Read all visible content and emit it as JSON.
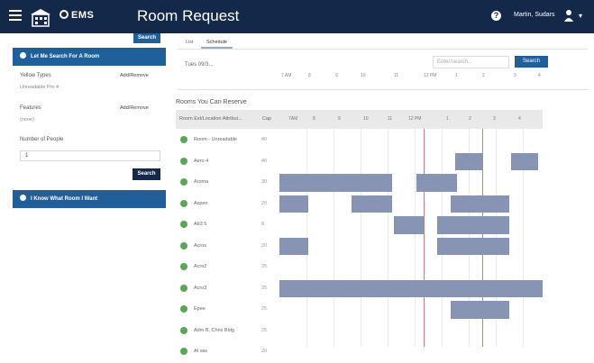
{
  "header": {
    "logo_text": "EMS",
    "title": "Room Request",
    "user_name": "Martin, Sudars"
  },
  "sidebar": {
    "top_search_label": "Search",
    "panel1_title": "Let Me Search For A Room",
    "fields": [
      {
        "label": "Yellow Types",
        "link": "Add/Remove",
        "value": "Unreadable Pro 4"
      },
      {
        "label": "Features",
        "link": "Add/Remove",
        "value": "(none)"
      }
    ],
    "people_label": "Number of People",
    "people_value": "1",
    "search_label": "Search",
    "panel2_title": "I Know What Room I Want"
  },
  "main": {
    "tabs": [
      "List",
      "Schedule"
    ],
    "active_tab": 1,
    "date_label": "Tues 09/3...",
    "date_placeholder": "Enter/search...",
    "search_label": "Search",
    "timebar": [
      "7 AM",
      "8",
      "9",
      "10",
      "11",
      "12 PM",
      "1",
      "2",
      "3",
      "4"
    ],
    "section_title": "Rooms You Can Reserve",
    "col_room": "Room Ext/Location Attribut...",
    "col_cap": "Cap",
    "hours": [
      "7AM",
      "8",
      "9",
      "10",
      "11",
      "12 PM",
      "1",
      "2",
      "3",
      "4"
    ],
    "rooms": [
      {
        "name": "Room - Unreadable",
        "cap": "40"
      },
      {
        "name": "Aero 4",
        "cap": "40"
      },
      {
        "name": "Aroma",
        "cap": "30"
      },
      {
        "name": "Aspen",
        "cap": "20"
      },
      {
        "name": "Att3 5",
        "cap": "8"
      },
      {
        "name": "Acros",
        "cap": "20"
      },
      {
        "name": "Acro2",
        "cap": "25"
      },
      {
        "name": "Acro3",
        "cap": "25"
      },
      {
        "name": "Epee",
        "cap": "25"
      },
      {
        "name": "Adm B, Chris Bldg",
        "cap": "25"
      },
      {
        "name": "At xxx",
        "cap": "20"
      }
    ],
    "accent_color": "#14284a",
    "booking_color": "#8794b4"
  }
}
